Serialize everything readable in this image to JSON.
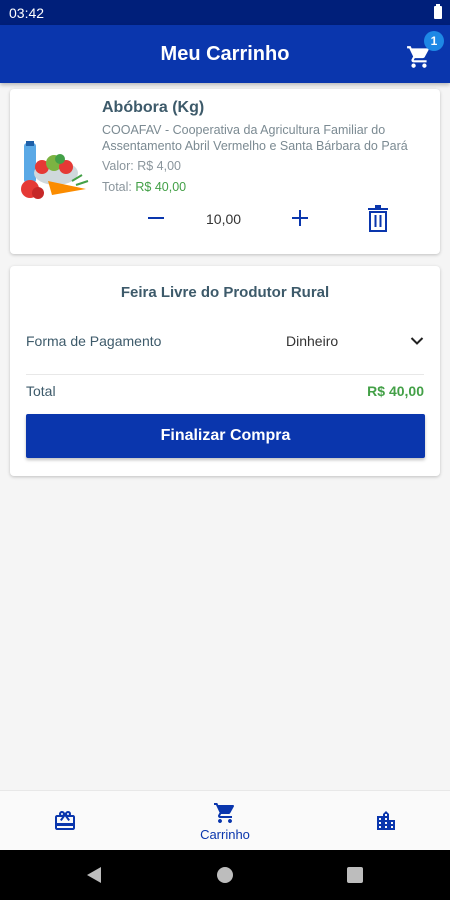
{
  "status_bar": {
    "time": "03:42"
  },
  "header": {
    "title": "Meu Carrinho",
    "cart_count": "1"
  },
  "cart_item": {
    "name": "Abóbora (Kg)",
    "cooperative": "COOAFAV - Cooperativa da Agricultura Familiar do Assentamento Abril Vermelho e Santa Bárbara do Pará",
    "price_label": "Valor:",
    "price": "R$ 4,00",
    "total_label": "Total:",
    "total": "R$ 40,00",
    "quantity": "10,00"
  },
  "summary": {
    "market": "Feira Livre do Produtor Rural",
    "payment_label": "Forma de Pagamento",
    "payment_value": "Dinheiro",
    "total_label": "Total",
    "total_value": "R$ 40,00",
    "checkout_label": "Finalizar Compra"
  },
  "bottom_nav": {
    "cart_label": "Carrinho"
  },
  "colors": {
    "primary": "#0a36ad",
    "status": "#001f7a",
    "accent_green": "#43a047",
    "badge": "#1e88e5"
  }
}
